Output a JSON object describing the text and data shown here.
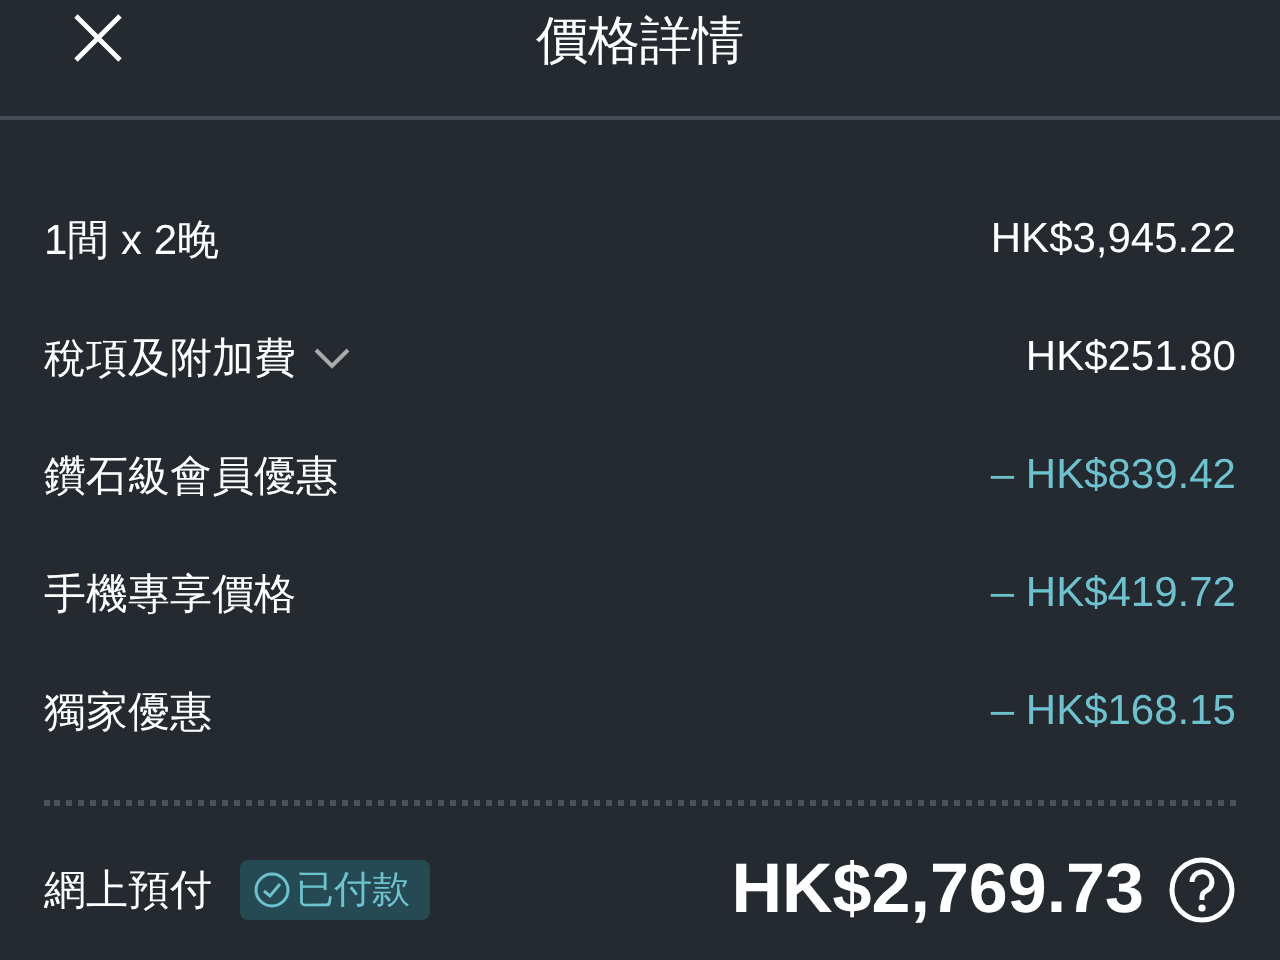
{
  "header": {
    "title": "價格詳情"
  },
  "lines": [
    {
      "label": "1間 x 2晚",
      "amount": "HK$3,945.22",
      "kind": "charge",
      "expandable": false
    },
    {
      "label": "稅項及附加費",
      "amount": "HK$251.80",
      "kind": "charge",
      "expandable": true,
      "expanded": false
    },
    {
      "label": "鑽石級會員優惠",
      "amount": "– HK$839.42",
      "kind": "discount",
      "expandable": false
    },
    {
      "label": "手機專享價格",
      "amount": "– HK$419.72",
      "kind": "discount",
      "expandable": false
    },
    {
      "label": "獨家優惠",
      "amount": "– HK$168.15",
      "kind": "discount",
      "expandable": false
    }
  ],
  "total": {
    "label": "網上預付",
    "badge": "已付款",
    "amount": "HK$2,769.73"
  }
}
